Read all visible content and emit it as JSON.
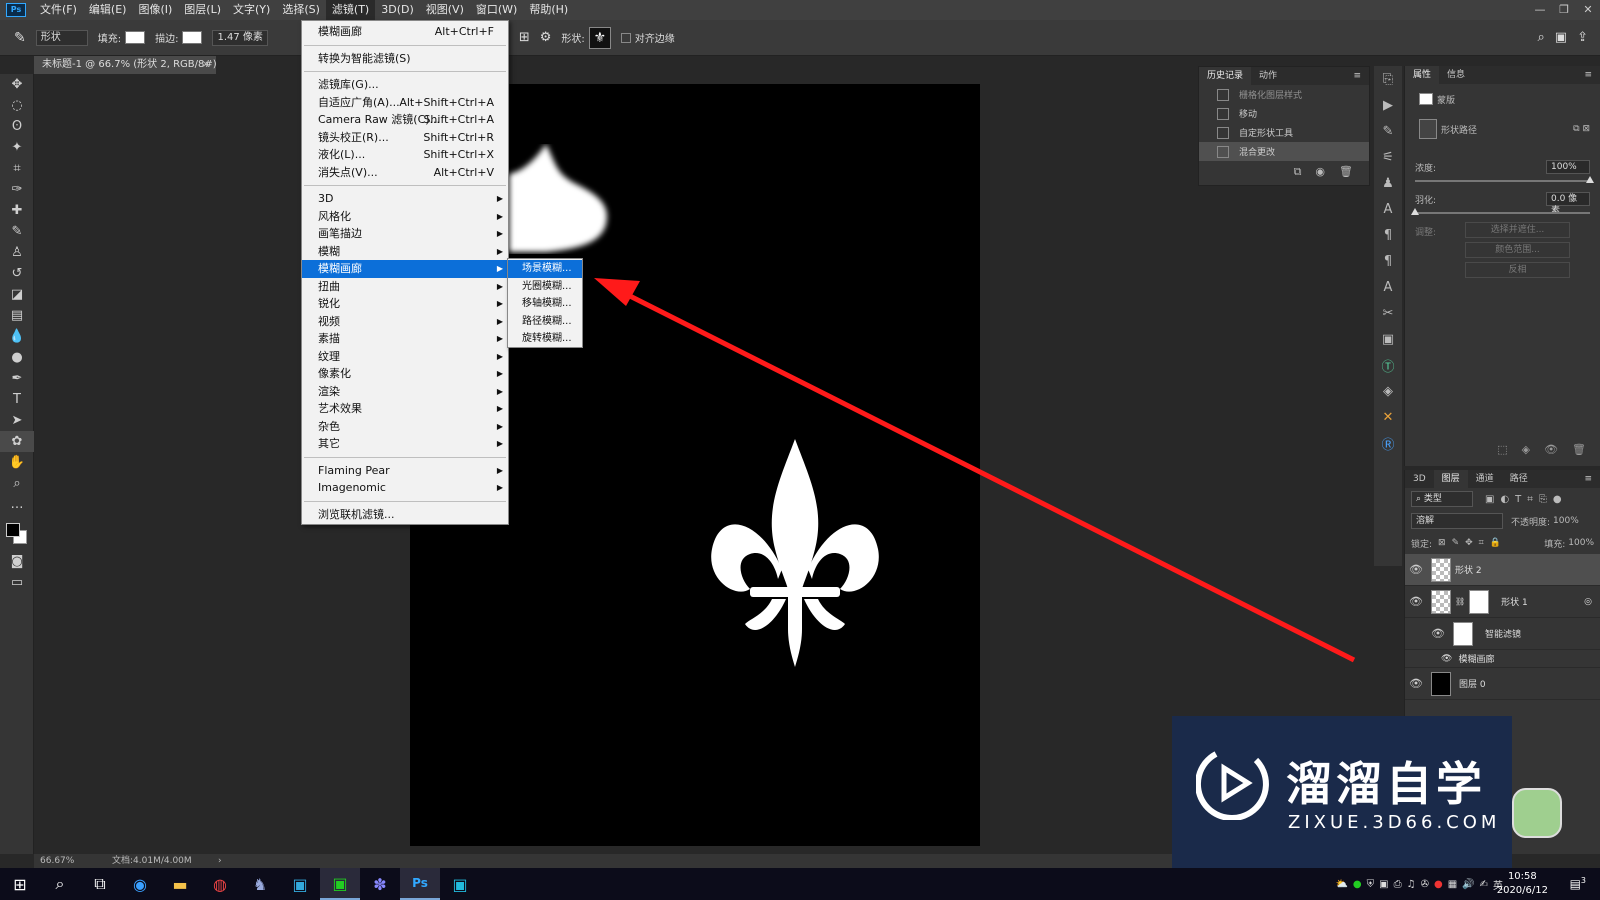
{
  "app": {
    "logo_text": "Ps"
  },
  "menubar": {
    "items": [
      "文件(F)",
      "编辑(E)",
      "图像(I)",
      "图层(L)",
      "文字(Y)",
      "选择(S)",
      "滤镜(T)",
      "3D(D)",
      "视图(V)",
      "窗口(W)",
      "帮助(H)"
    ],
    "active_index": 6
  },
  "options_bar": {
    "tool_mode": "形状",
    "fill_label": "填充:",
    "stroke_label": "描边:",
    "stroke_width": "1.47 像素",
    "shape_label": "形状:",
    "align_edges_label": "对齐边缘"
  },
  "document_tab": {
    "title": "未标题-1 @ 66.7% (形状 2, RGB/8#) *",
    "close": "×"
  },
  "filter_menu": {
    "items": [
      {
        "label": "模糊画廊",
        "shortcut": "Alt+Ctrl+F"
      },
      {
        "sep": true
      },
      {
        "label": "转换为智能滤镜(S)"
      },
      {
        "sep": true
      },
      {
        "label": "滤镜库(G)..."
      },
      {
        "label": "自适应广角(A)...",
        "shortcut": "Alt+Shift+Ctrl+A"
      },
      {
        "label": "Camera Raw 滤镜(C)...",
        "shortcut": "Shift+Ctrl+A"
      },
      {
        "label": "镜头校正(R)...",
        "shortcut": "Shift+Ctrl+R"
      },
      {
        "label": "液化(L)...",
        "shortcut": "Shift+Ctrl+X"
      },
      {
        "label": "消失点(V)...",
        "shortcut": "Alt+Ctrl+V"
      },
      {
        "sep": true
      },
      {
        "label": "3D",
        "submenu": true
      },
      {
        "label": "风格化",
        "submenu": true
      },
      {
        "label": "画笔描边",
        "submenu": true
      },
      {
        "label": "模糊",
        "submenu": true
      },
      {
        "label": "模糊画廊",
        "submenu": true,
        "highlighted": true
      },
      {
        "label": "扭曲",
        "submenu": true
      },
      {
        "label": "锐化",
        "submenu": true
      },
      {
        "label": "视频",
        "submenu": true
      },
      {
        "label": "素描",
        "submenu": true
      },
      {
        "label": "纹理",
        "submenu": true
      },
      {
        "label": "像素化",
        "submenu": true
      },
      {
        "label": "渲染",
        "submenu": true
      },
      {
        "label": "艺术效果",
        "submenu": true
      },
      {
        "label": "杂色",
        "submenu": true
      },
      {
        "label": "其它",
        "submenu": true
      },
      {
        "sep": true
      },
      {
        "label": "Flaming Pear",
        "submenu": true
      },
      {
        "label": "Imagenomic",
        "submenu": true
      },
      {
        "sep": true
      },
      {
        "label": "浏览联机滤镜..."
      }
    ]
  },
  "blur_gallery_submenu": {
    "items": [
      "场景模糊...",
      "光圈模糊...",
      "移轴模糊...",
      "路径模糊...",
      "旋转模糊..."
    ],
    "highlighted_index": 0
  },
  "history_panel": {
    "tabs": [
      "历史记录",
      "动作"
    ],
    "rows": [
      {
        "label": "栅格化图层样式"
      },
      {
        "label": "移动"
      },
      {
        "label": "自定形状工具"
      },
      {
        "label": "混合更改",
        "selected": true
      }
    ]
  },
  "properties_panel": {
    "tabs": [
      "属性",
      "信息"
    ],
    "mask_label": "蒙版",
    "vector_mask_label": "形状路径",
    "density_label": "浓度:",
    "density_value": "100%",
    "feather_label": "羽化:",
    "feather_value": "0.0 像素",
    "refine_label": "调整:",
    "buttons": [
      "选择并遮住...",
      "颜色范围...",
      "反相"
    ]
  },
  "layers_panel": {
    "tabs": [
      "3D",
      "图层",
      "通道",
      "路径"
    ],
    "active_tab": 1,
    "filter_type": "类型",
    "blend_mode": "溶解",
    "opacity_label": "不透明度:",
    "opacity_value": "100%",
    "lock_label": "锁定:",
    "fill_label": "填充:",
    "fill_value": "100%",
    "layers": [
      {
        "name": "形状 2",
        "thumb": "checker",
        "selected": true
      },
      {
        "name": "形状 1",
        "thumb": "checker-mask"
      },
      {
        "name": "智能滤镜",
        "thumb": "white",
        "indent": true
      },
      {
        "name": "模糊画廊",
        "thumb": "none",
        "indent": true
      },
      {
        "name": "图层 0",
        "thumb": "black"
      }
    ]
  },
  "status_bar": {
    "zoom": "66.67%",
    "doc_info": "文档:4.01M/4.00M"
  },
  "watermark": {
    "title": "溜溜自学",
    "subtitle": "ZIXUE.3D66.COM"
  },
  "taskbar": {
    "time": "10:58",
    "date": "2020/6/12",
    "ime_label": "英",
    "notification_count": "3"
  },
  "colors": {
    "accent": "#0c6fd9",
    "arrow": "#ff1a1a",
    "canvas": "#000000"
  }
}
